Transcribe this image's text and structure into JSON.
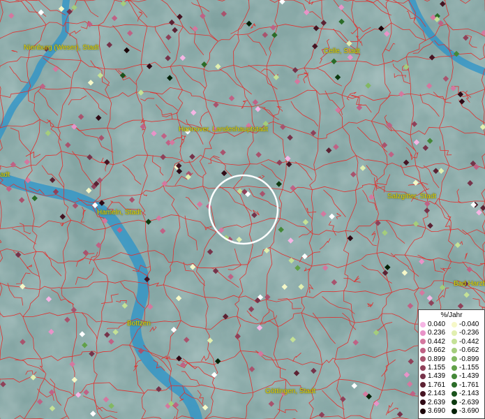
{
  "map": {
    "places": [
      {
        "name": "Nienburg (Weser), Stadt"
      },
      {
        "name": "Celle, Stadt"
      },
      {
        "name": "Hannover, Landeshauptstadt"
      },
      {
        "name": "Hameln, Stadt"
      },
      {
        "name": "Salzgitter, Stadt"
      },
      {
        "name": "Bad Harzburg"
      },
      {
        "name": "Bottzen"
      },
      {
        "name": "Göttingen, Stadt"
      },
      {
        "name": "adt"
      }
    ],
    "colors": {
      "boundary": "#e0312f",
      "river": "#2a93c9",
      "label": "#e8d800",
      "marker_ring": "#ffffff"
    }
  },
  "legend": {
    "title": "%/Jahr",
    "positive": [
      {
        "label": "0.040",
        "color": "#f5b5e4"
      },
      {
        "label": "0.236",
        "color": "#e893c8"
      },
      {
        "label": "0.442",
        "color": "#d4789f"
      },
      {
        "label": "0.662",
        "color": "#bf6285"
      },
      {
        "label": "0.899",
        "color": "#a8536d"
      },
      {
        "label": "1.155",
        "color": "#8f4159"
      },
      {
        "label": "1.439",
        "color": "#76334a"
      },
      {
        "label": "1.761",
        "color": "#5c2233"
      },
      {
        "label": "2.143",
        "color": "#451422"
      },
      {
        "label": "2.639",
        "color": "#300a15"
      },
      {
        "label": "3.690",
        "color": "#1b0408"
      }
    ],
    "negative": [
      {
        "label": "-0.040",
        "color": "#f6f8c8"
      },
      {
        "label": "-0.236",
        "color": "#e1efb0"
      },
      {
        "label": "-0.442",
        "color": "#c4e196"
      },
      {
        "label": "-0.662",
        "color": "#a4cd7c"
      },
      {
        "label": "-0.899",
        "color": "#82b862"
      },
      {
        "label": "-1.155",
        "color": "#61a048"
      },
      {
        "label": "-1.439",
        "color": "#448838"
      },
      {
        "label": "-1.761",
        "color": "#2b6c28"
      },
      {
        "label": "-2.143",
        "color": "#1a531c"
      },
      {
        "label": "-2.639",
        "color": "#0d3a10"
      },
      {
        "label": "-3.690",
        "color": "#052107"
      }
    ]
  }
}
